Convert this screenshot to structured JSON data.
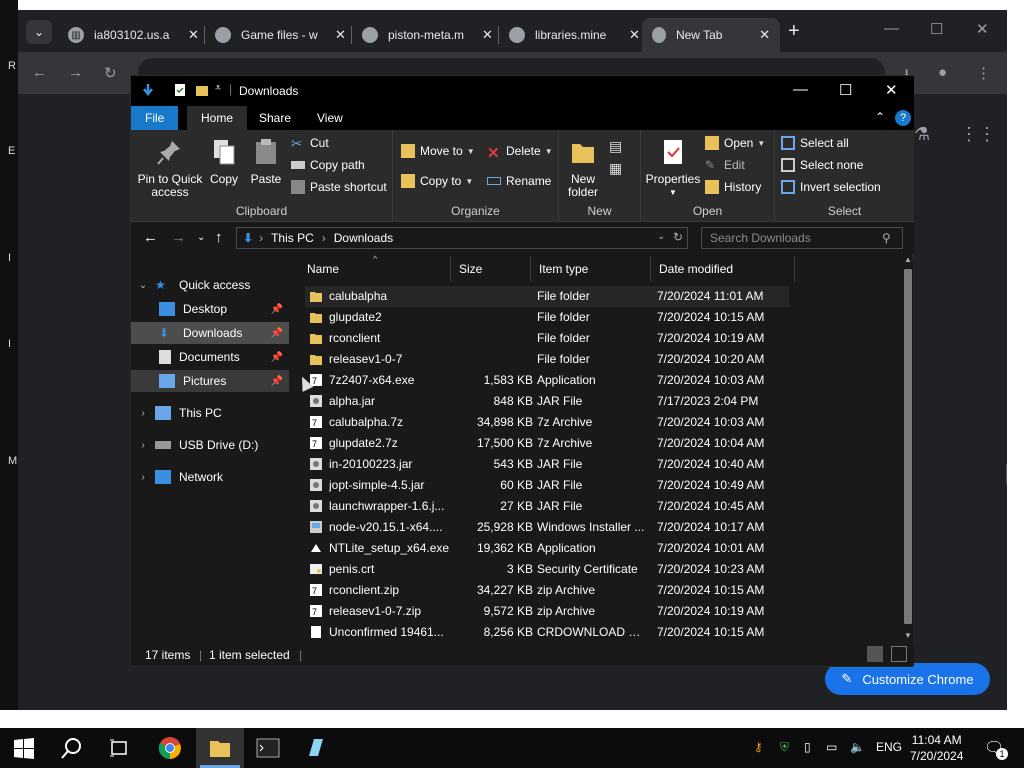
{
  "desktop": {
    "fragments": [
      "R",
      "E",
      "I",
      "I",
      "M"
    ]
  },
  "chrome": {
    "tabs": [
      {
        "label": "ia803102.us.a",
        "icon": "archive-icon"
      },
      {
        "label": "Game files - w",
        "icon": "globe-icon"
      },
      {
        "label": "piston-meta.m",
        "icon": "globe-icon"
      },
      {
        "label": "libraries.mine",
        "icon": "globe-icon"
      },
      {
        "label": "New Tab",
        "icon": "chrome-icon",
        "active": true
      }
    ],
    "new_tab": "+",
    "omnibox_value": "",
    "customize_label": "Customize Chrome"
  },
  "explorer": {
    "title": "Downloads",
    "ribbon_tabs": [
      "File",
      "Home",
      "Share",
      "View"
    ],
    "clipboard": {
      "pin_label": "Pin to Quick access",
      "copy_label": "Copy",
      "paste_label": "Paste",
      "cut_label": "Cut",
      "copy_path_label": "Copy path",
      "paste_shortcut_label": "Paste shortcut",
      "group_label": "Clipboard"
    },
    "organize": {
      "move_to_label": "Move to",
      "copy_to_label": "Copy to",
      "delete_label": "Delete",
      "rename_label": "Rename",
      "group_label": "Organize"
    },
    "new_group": {
      "new_folder_label": "New folder",
      "group_label": "New"
    },
    "open_group": {
      "properties_label": "Properties",
      "open_label": "Open",
      "edit_label": "Edit",
      "history_label": "History",
      "group_label": "Open"
    },
    "select_group": {
      "select_all_label": "Select all",
      "select_none_label": "Select none",
      "invert_label": "Invert selection",
      "group_label": "Select"
    },
    "breadcrumb": [
      "This PC",
      "Downloads"
    ],
    "search_placeholder": "Search Downloads",
    "nav": {
      "quick_access": "Quick access",
      "items": [
        {
          "label": "Desktop",
          "pinned": true
        },
        {
          "label": "Downloads",
          "pinned": true,
          "selected": true
        },
        {
          "label": "Documents",
          "pinned": true
        },
        {
          "label": "Pictures",
          "pinned": true
        }
      ],
      "this_pc": "This PC",
      "usb": "USB Drive (D:)",
      "network": "Network"
    },
    "columns": [
      "Name",
      "Size",
      "Item type",
      "Date modified"
    ],
    "files": [
      {
        "name": "calubalpha",
        "size": "",
        "type": "File folder",
        "date": "7/20/2024 11:01 AM",
        "icon": "folder"
      },
      {
        "name": "glupdate2",
        "size": "",
        "type": "File folder",
        "date": "7/20/2024 10:15 AM",
        "icon": "folder"
      },
      {
        "name": "rconclient",
        "size": "",
        "type": "File folder",
        "date": "7/20/2024 10:19 AM",
        "icon": "folder"
      },
      {
        "name": "releasev1-0-7",
        "size": "",
        "type": "File folder",
        "date": "7/20/2024 10:20 AM",
        "icon": "folder"
      },
      {
        "name": "7z2407-x64.exe",
        "size": "1,583 KB",
        "type": "Application",
        "date": "7/20/2024 10:03 AM",
        "icon": "7z"
      },
      {
        "name": "alpha.jar",
        "size": "848 KB",
        "type": "JAR File",
        "date": "7/17/2023 2:04 PM",
        "icon": "jar"
      },
      {
        "name": "calubalpha.7z",
        "size": "34,898 KB",
        "type": "7z Archive",
        "date": "7/20/2024 10:03 AM",
        "icon": "7z"
      },
      {
        "name": "glupdate2.7z",
        "size": "17,500 KB",
        "type": "7z Archive",
        "date": "7/20/2024 10:04 AM",
        "icon": "7z"
      },
      {
        "name": "in-20100223.jar",
        "size": "543 KB",
        "type": "JAR File",
        "date": "7/20/2024 10:40 AM",
        "icon": "jar"
      },
      {
        "name": "jopt-simple-4.5.jar",
        "size": "60 KB",
        "type": "JAR File",
        "date": "7/20/2024 10:49 AM",
        "icon": "jar"
      },
      {
        "name": "launchwrapper-1.6.j...",
        "size": "27 KB",
        "type": "JAR File",
        "date": "7/20/2024 10:45 AM",
        "icon": "jar"
      },
      {
        "name": "node-v20.15.1-x64....",
        "size": "25,928 KB",
        "type": "Windows Installer ...",
        "date": "7/20/2024 10:17 AM",
        "icon": "msi"
      },
      {
        "name": "NTLite_setup_x64.exe",
        "size": "19,362 KB",
        "type": "Application",
        "date": "7/20/2024 10:01 AM",
        "icon": "app"
      },
      {
        "name": "penis.crt",
        "size": "3 KB",
        "type": "Security Certificate",
        "date": "7/20/2024 10:23 AM",
        "icon": "cert"
      },
      {
        "name": "rconclient.zip",
        "size": "34,227 KB",
        "type": "zip Archive",
        "date": "7/20/2024 10:15 AM",
        "icon": "7z"
      },
      {
        "name": "releasev1-0-7.zip",
        "size": "9,572 KB",
        "type": "zip Archive",
        "date": "7/20/2024 10:19 AM",
        "icon": "7z"
      },
      {
        "name": "Unconfirmed 19461...",
        "size": "8,256 KB",
        "type": "CRDOWNLOAD File",
        "date": "7/20/2024 10:15 AM",
        "icon": "blank"
      }
    ],
    "status": {
      "count": "17 items",
      "selected": "1 item selected"
    }
  },
  "taskbar": {
    "lang": "ENG",
    "time": "11:04 AM",
    "date": "7/20/2024",
    "notification_count": "1"
  },
  "colors": {
    "accent": "#1979ca",
    "chrome_blue": "#1a73e8",
    "folder": "#e8c15a"
  }
}
